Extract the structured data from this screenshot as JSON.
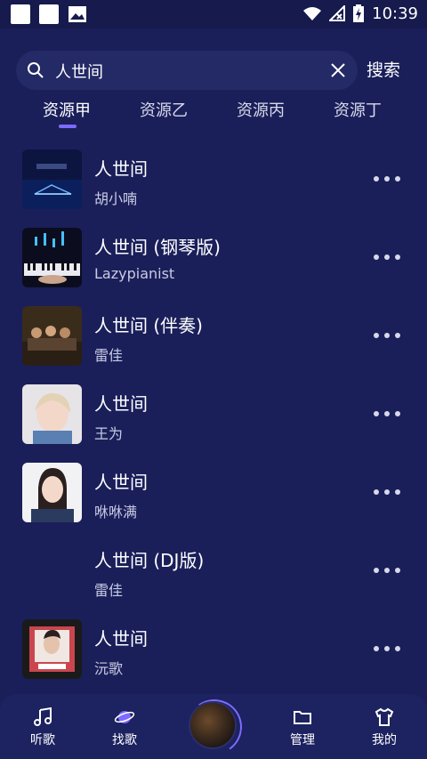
{
  "status": {
    "time": "10:39"
  },
  "search": {
    "value": "人世间",
    "button_label": "搜索"
  },
  "tabs": [
    {
      "label": "资源甲",
      "active": true
    },
    {
      "label": "资源乙",
      "active": false
    },
    {
      "label": "资源丙",
      "active": false
    },
    {
      "label": "资源丁",
      "active": false
    }
  ],
  "songs": [
    {
      "title": "人世间",
      "artist": "胡小喃",
      "cover": "night-stage"
    },
    {
      "title": "人世间 (钢琴版)",
      "artist": "Lazypianist",
      "cover": "piano-keys"
    },
    {
      "title": "人世间 (伴奏)",
      "artist": "雷佳",
      "cover": "drama-poster"
    },
    {
      "title": "人世间",
      "artist": "王为",
      "cover": "portrait-girl"
    },
    {
      "title": "人世间",
      "artist": "咻咻满",
      "cover": "portrait-woman"
    },
    {
      "title": "人世间 (DJ版)",
      "artist": "雷佳",
      "cover": "none"
    },
    {
      "title": "人世间",
      "artist": "沅歌",
      "cover": "portrait-man"
    }
  ],
  "bottom_nav": [
    {
      "label": "听歌",
      "icon": "music-note-icon"
    },
    {
      "label": "找歌",
      "icon": "planet-icon"
    },
    {
      "label": "管理",
      "icon": "folder-icon"
    },
    {
      "label": "我的",
      "icon": "shirt-icon"
    }
  ]
}
